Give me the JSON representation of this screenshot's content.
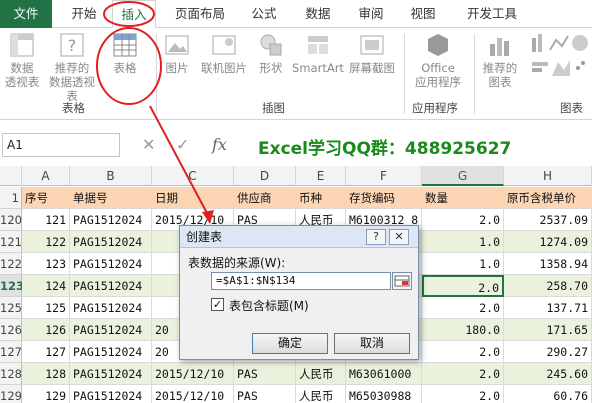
{
  "ribbon_tabs": [
    "文件",
    "开始",
    "插入",
    "页面布局",
    "公式",
    "数据",
    "审阅",
    "视图",
    "开发工具"
  ],
  "ribbon": {
    "buttons": [
      "数据\n透视表",
      "推荐的\n数据透视表",
      "表格",
      "图片",
      "联机图片",
      "形状",
      "SmartArt",
      "屏幕截图",
      "Office\n应用程序",
      "推荐的\n图表"
    ],
    "groups": [
      "表格",
      "插图",
      "应用程序",
      "图表"
    ]
  },
  "formula_bar": {
    "name_box": "A1",
    "cancel": "✕",
    "enter": "✓",
    "fx": "fx"
  },
  "promo_text": "Excel学习QQ群：488925627",
  "columns": [
    "A",
    "B",
    "C",
    "D",
    "E",
    "F",
    "G",
    "H"
  ],
  "selected_column": "G",
  "header_row": {
    "row": "1",
    "cells": [
      "序号",
      "单据号",
      "日期",
      "供应商",
      "币种",
      "存货编码",
      "数量",
      "原币含税单价"
    ]
  },
  "rows": [
    {
      "row": "120",
      "cells": [
        "121",
        "PAG1512024",
        "2015/12/10",
        "PAS",
        "人民币",
        "M6100312 8",
        "2.0",
        "2537.09"
      ]
    },
    {
      "row": "121",
      "cells": [
        "122",
        "PAG1512024",
        "",
        "",
        "",
        "",
        "1.0",
        "1274.09"
      ]
    },
    {
      "row": "122",
      "cells": [
        "123",
        "PAG1512024",
        "",
        "",
        "",
        "",
        "1.0",
        "1358.94"
      ]
    },
    {
      "row": "123",
      "cells": [
        "124",
        "PAG1512024",
        "",
        "",
        "",
        "",
        "2.0",
        "258.70"
      ]
    },
    {
      "row": "125",
      "cells": [
        "125",
        "PAG1512024",
        "",
        "",
        "",
        "",
        "2.0",
        "137.71"
      ]
    },
    {
      "row": "126",
      "cells": [
        "126",
        "PAG1512024",
        "20",
        "",
        "",
        "",
        "180.0",
        "171.65"
      ]
    },
    {
      "row": "127",
      "cells": [
        "127",
        "PAG1512024",
        "20",
        "",
        "",
        "",
        "2.0",
        "290.27"
      ]
    },
    {
      "row": "128",
      "cells": [
        "128",
        "PAG1512024",
        "2015/12/10",
        "PAS",
        "人民币",
        "M63061000",
        "2.0",
        "245.60"
      ]
    },
    {
      "row": "129",
      "cells": [
        "129",
        "PAG1512024",
        "2015/12/10",
        "PAS",
        "人民币",
        "M65030988",
        "2.0",
        "60.76"
      ]
    }
  ],
  "dialog": {
    "title": "创建表",
    "help": "?",
    "close": "✕",
    "source_label": "表数据的来源(W):",
    "source_value": "=$A$1:$N$134",
    "checkbox_label": "表包含标题(M)",
    "checkbox_checked": true,
    "ok": "确定",
    "cancel": "取消"
  },
  "annotation_color": "#e02020"
}
